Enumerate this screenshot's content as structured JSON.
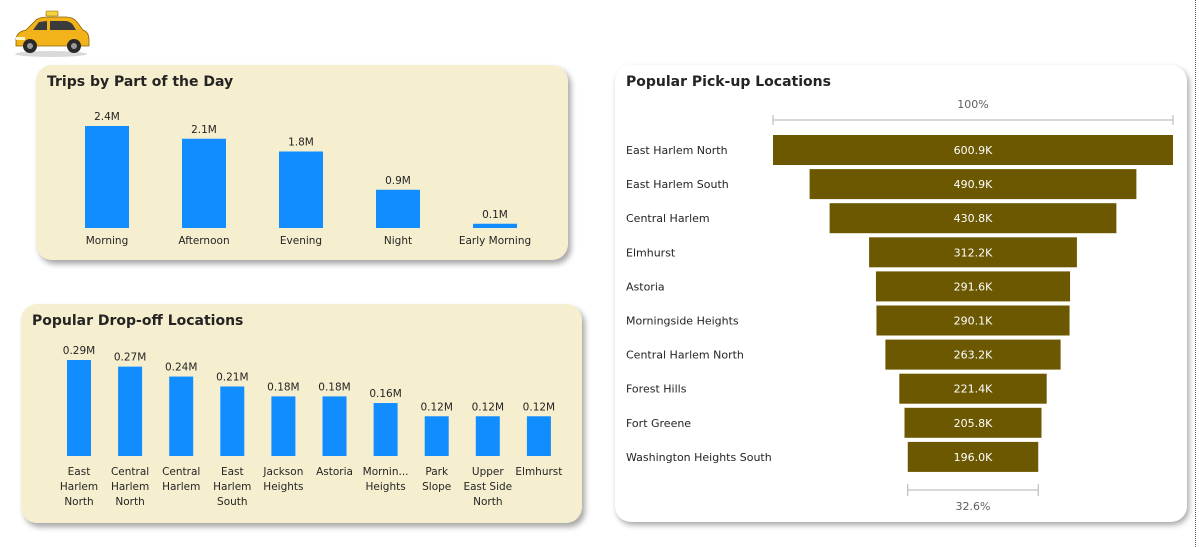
{
  "colors": {
    "bar": "#118dff",
    "funnel": "#6b5800",
    "card_beige": "#f5efd0"
  },
  "logo": {
    "icon": "taxi-icon"
  },
  "chart_data": [
    {
      "type": "bar",
      "title": "Trips by Part of the Day",
      "categories": [
        "Morning",
        "Afternoon",
        "Evening",
        "Night",
        "Early Morning"
      ],
      "values": [
        2.4,
        2.1,
        1.8,
        0.9,
        0.1
      ],
      "value_labels": [
        "2.4M",
        "2.1M",
        "1.8M",
        "0.9M",
        "0.1M"
      ],
      "unit": "M",
      "ylim": [
        0,
        2.4
      ]
    },
    {
      "type": "bar",
      "title": "Popular Drop-off Locations",
      "categories": [
        "East Harlem North",
        "Central Harlem North",
        "Central Harlem",
        "East Harlem South",
        "Jackson Heights",
        "Astoria",
        "Mornin... Heights",
        "Park Slope",
        "Upper East Side North",
        "Elmhurst"
      ],
      "category_lines": [
        [
          "East",
          "Harlem",
          "North"
        ],
        [
          "Central",
          "Harlem",
          "North"
        ],
        [
          "Central",
          "Harlem"
        ],
        [
          "East",
          "Harlem",
          "South"
        ],
        [
          "Jackson",
          "Heights"
        ],
        [
          "Astoria"
        ],
        [
          "Mornin...",
          "Heights"
        ],
        [
          "Park",
          "Slope"
        ],
        [
          "Upper",
          "East Side",
          "North"
        ],
        [
          "Elmhurst"
        ]
      ],
      "values": [
        0.29,
        0.27,
        0.24,
        0.21,
        0.18,
        0.18,
        0.16,
        0.12,
        0.12,
        0.12
      ],
      "value_labels": [
        "0.29M",
        "0.27M",
        "0.24M",
        "0.21M",
        "0.18M",
        "0.18M",
        "0.16M",
        "0.12M",
        "0.12M",
        "0.12M"
      ],
      "unit": "M",
      "ylim": [
        0,
        0.29
      ]
    },
    {
      "type": "funnel",
      "title": "Popular Pick-up Locations",
      "categories": [
        "East Harlem North",
        "East Harlem South",
        "Central Harlem",
        "Elmhurst",
        "Astoria",
        "Morningside Heights",
        "Central Harlem North",
        "Forest Hills",
        "Fort Greene",
        "Washington Heights South"
      ],
      "values": [
        600.9,
        490.9,
        430.8,
        312.2,
        291.6,
        290.1,
        263.2,
        221.4,
        205.8,
        196.0
      ],
      "value_labels": [
        "600.9K",
        "490.9K",
        "430.8K",
        "312.2K",
        "291.6K",
        "290.1K",
        "263.2K",
        "221.4K",
        "205.8K",
        "196.0K"
      ],
      "unit": "K",
      "top_percent_label": "100%",
      "bottom_percent_label": "32.6%"
    }
  ]
}
